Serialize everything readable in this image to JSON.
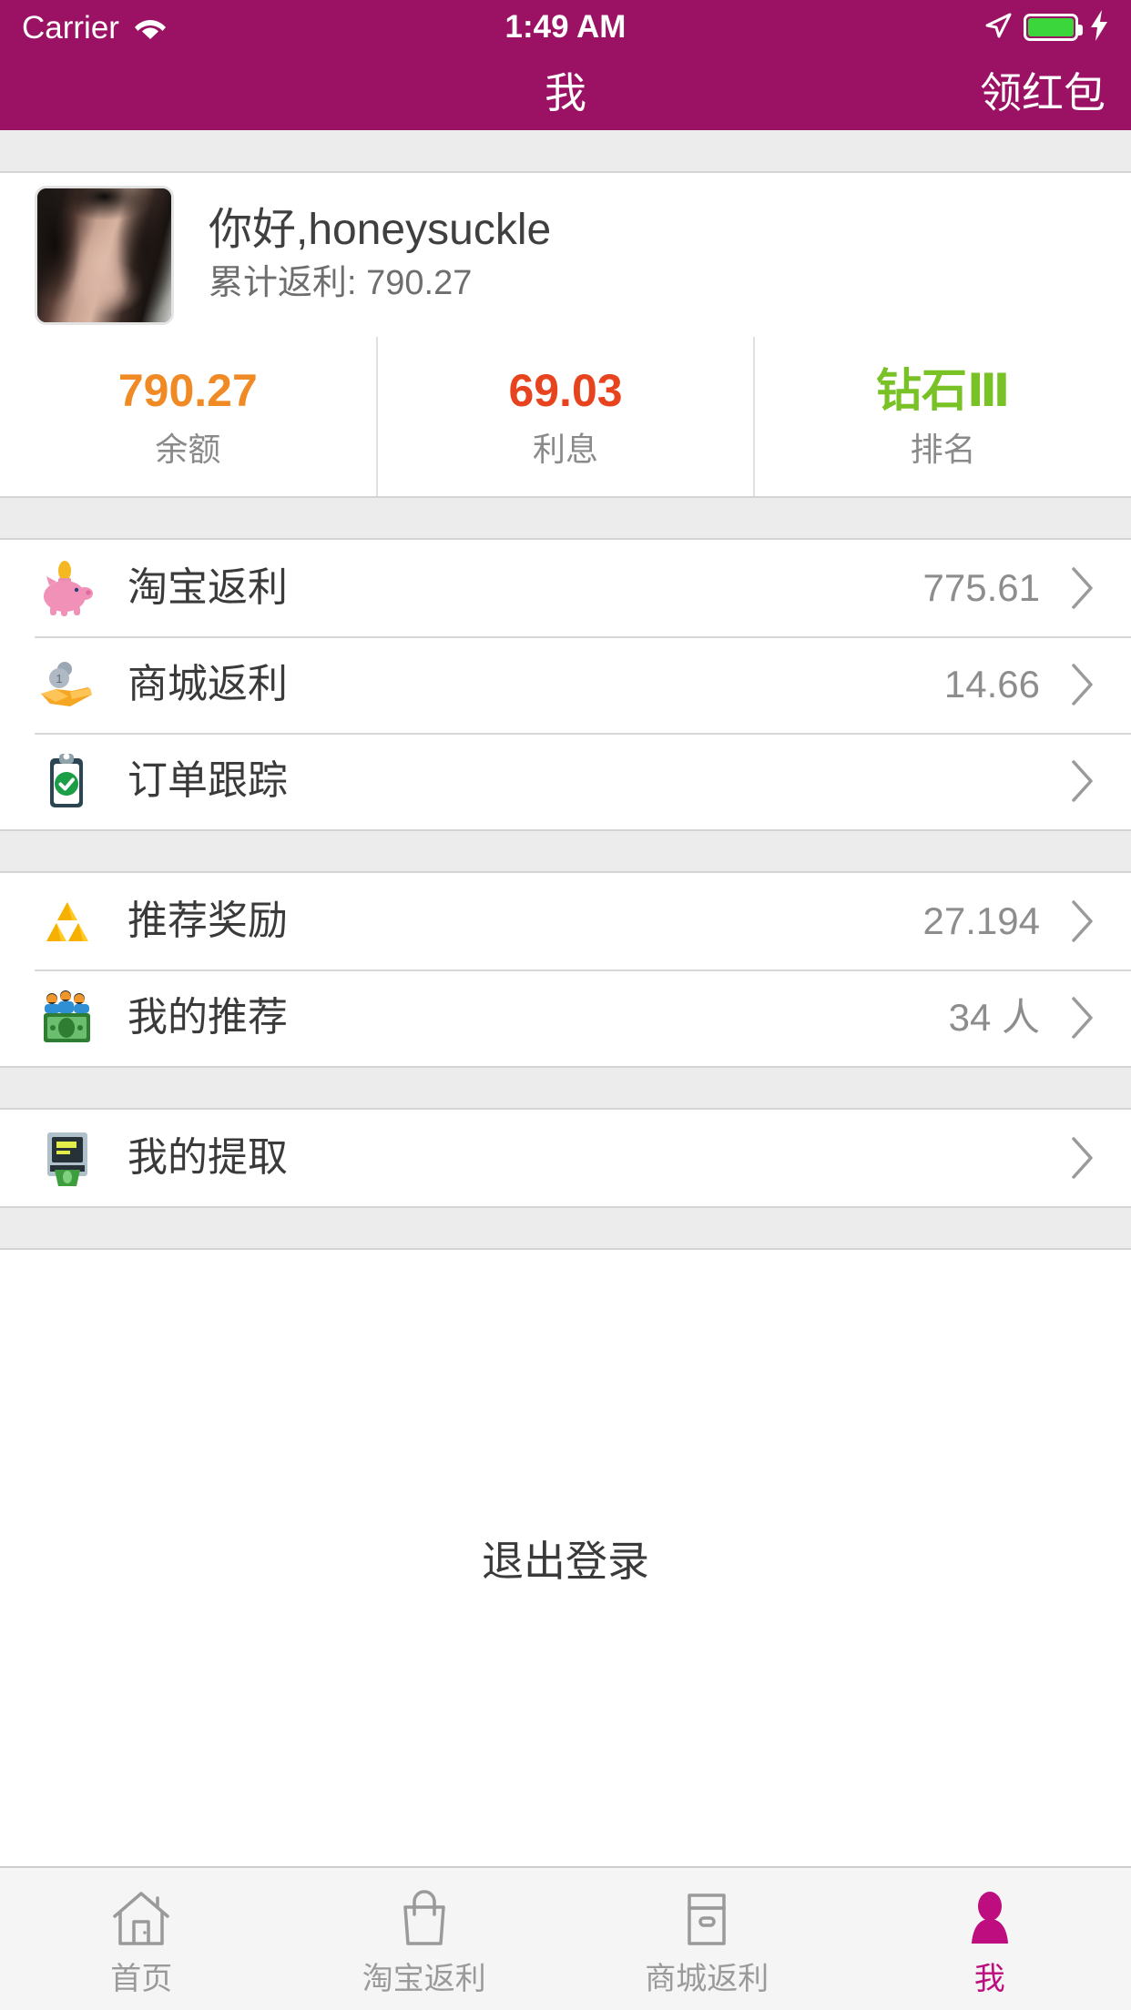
{
  "theme": {
    "header_bg": "#9B1163",
    "accent": "#BE0D7E",
    "balance_color": "#F08A24",
    "interest_color": "#E8431F",
    "rank_color": "#79C225",
    "band_bg": "#ECECEC",
    "page_bg": "#FFFFFF"
  },
  "status_bar": {
    "carrier": "Carrier",
    "time": "1:49 AM",
    "wifi_icon": "wifi-icon",
    "location_icon": "location-arrow-icon",
    "battery_icon": "battery-icon",
    "charging_icon": "lightning-bolt-icon"
  },
  "navbar": {
    "title": "我",
    "action_label": "领红包"
  },
  "profile": {
    "avatar_name": "user-avatar-photo",
    "greeting": "你好,honeysuckle",
    "cumulative_rebate": "累计返利: 790.27"
  },
  "stats": [
    {
      "value": "790.27",
      "label": "余额",
      "color": "#F08A24"
    },
    {
      "value": "69.03",
      "label": "利息",
      "color": "#E8431F"
    },
    {
      "value": "钻石Ⅲ",
      "label": "排名",
      "color": "#79C225"
    }
  ],
  "groups": [
    {
      "rows": [
        {
          "icon": "piggy-bank-icon",
          "label": "淘宝返利",
          "value": "775.61"
        },
        {
          "icon": "coin-in-hand-icon",
          "label": "商城返利",
          "value": "14.66"
        },
        {
          "icon": "clipboard-check-icon",
          "label": "订单跟踪",
          "value": ""
        }
      ]
    },
    {
      "rows": [
        {
          "icon": "gold-bars-icon",
          "label": "推荐奖励",
          "value": "27.194"
        },
        {
          "icon": "people-money-icon",
          "label": "我的推荐",
          "value": "34 人"
        }
      ]
    },
    {
      "rows": [
        {
          "icon": "atm-machine-icon",
          "label": "我的提取",
          "value": ""
        }
      ]
    }
  ],
  "logout": {
    "label": "退出登录"
  },
  "tabbar": {
    "items": [
      {
        "icon": "home-icon",
        "label": "首页",
        "active": false
      },
      {
        "icon": "shopping-bag-icon",
        "label": "淘宝返利",
        "active": false
      },
      {
        "icon": "store-icon",
        "label": "商城返利",
        "active": false
      },
      {
        "icon": "person-icon",
        "label": "我",
        "active": true
      }
    ]
  }
}
